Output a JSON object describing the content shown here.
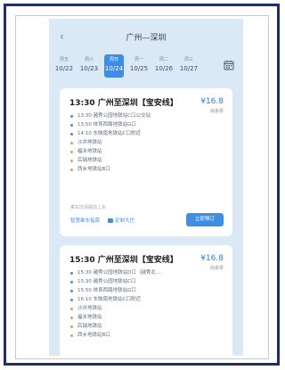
{
  "header": {
    "title": "广州—深圳"
  },
  "dates": [
    {
      "weekday": "周五",
      "date": "10/22",
      "active": false
    },
    {
      "weekday": "周六",
      "date": "10/23",
      "active": false
    },
    {
      "weekday": "周日",
      "date": "10/24",
      "active": true
    },
    {
      "weekday": "周一",
      "date": "10/25",
      "active": false
    },
    {
      "weekday": "周二",
      "date": "10/26",
      "active": false
    },
    {
      "weekday": "周三",
      "date": "10/27",
      "active": false
    }
  ],
  "cards": [
    {
      "title": "13:30 广州至深圳【宝安线】",
      "price": "¥16.8",
      "price_sub": "尚余票",
      "stops": [
        {
          "text": "13:30 越秀公园地铁站C口公交站",
          "color": "blue"
        },
        {
          "text": "13:50 体育西路地铁站G口",
          "color": "blue"
        },
        {
          "text": "14:10 车陂南地铁站C口附近",
          "color": "blue"
        },
        {
          "text": "沙井地铁站",
          "color": "orange"
        },
        {
          "text": "福永地铁站",
          "color": "orange"
        },
        {
          "text": "后瑞地铁站",
          "color": "orange"
        },
        {
          "text": "西乡地铁站B口",
          "color": "orange"
        }
      ],
      "note": "乘车前请提前上车",
      "link1": "智慧乘车指南",
      "link2": "定制大巴",
      "book_label": "立即预订"
    },
    {
      "title": "15:30 广州至深圳【宝安线】",
      "price": "¥16.8",
      "price_sub": "尚余票",
      "stops": [
        {
          "text": "15:30 越秀公园地铁站D口（越秀北…",
          "color": "blue"
        },
        {
          "text": "15:30 越秀公园地铁站C口",
          "color": "blue"
        },
        {
          "text": "15:50 体育西路地铁站G口",
          "color": "blue"
        },
        {
          "text": "16:10 车陂南地铁站C口附近",
          "color": "blue"
        },
        {
          "text": "沙井地铁站",
          "color": "orange"
        },
        {
          "text": "福永地铁站",
          "color": "orange"
        },
        {
          "text": "后瑞地铁站",
          "color": "orange"
        },
        {
          "text": "西乡地铁站B口",
          "color": "orange"
        }
      ]
    }
  ]
}
